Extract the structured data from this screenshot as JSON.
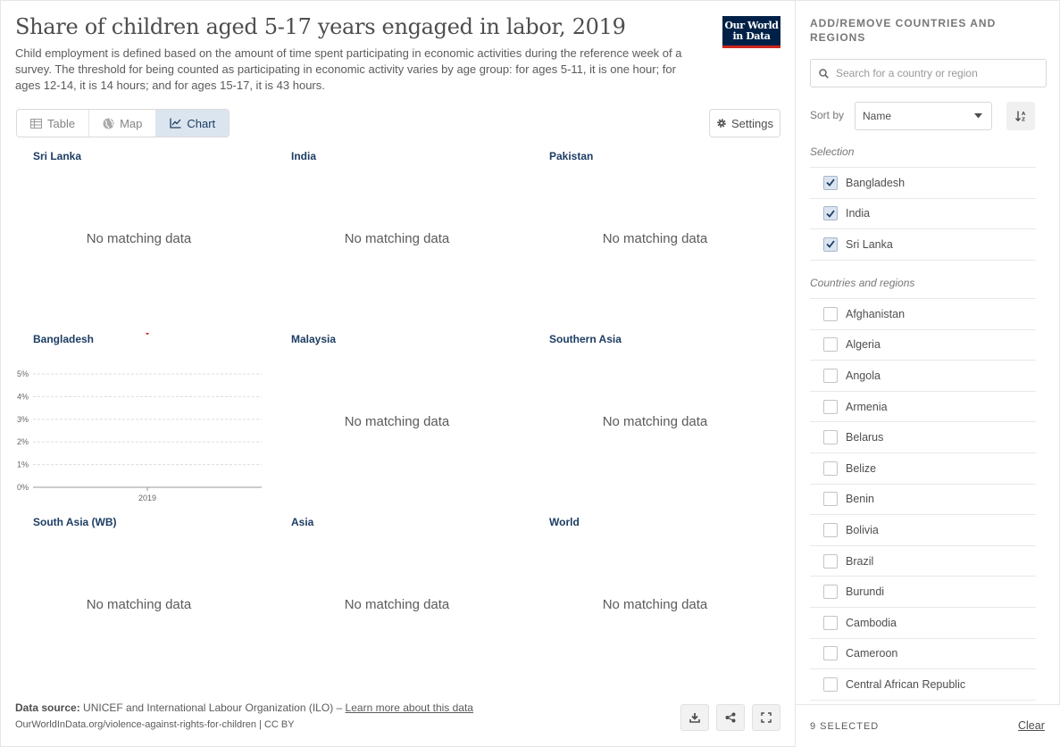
{
  "header": {
    "title": "Share of children aged 5-17 years engaged in labor, 2019",
    "subtitle": "Child employment is defined based on the amount of time spent participating in economic activities during the reference week of a survey. The threshold for being counted as participating in economic activity varies by age group: for ages 5-11, it is one hour; for ages 12-14, it is 14 hours; and for ages 15-17, it is 43 hours.",
    "logo_line1": "Our World",
    "logo_line2": "in Data"
  },
  "tabs": [
    {
      "label": "Table",
      "icon": "table-icon",
      "active": false
    },
    {
      "label": "Map",
      "icon": "globe-icon",
      "active": false
    },
    {
      "label": "Chart",
      "icon": "line-chart-icon",
      "active": true
    }
  ],
  "settings_label": "Settings",
  "no_data_text": "No matching data",
  "facets": [
    {
      "name": "Sri Lanka",
      "has_data": false
    },
    {
      "name": "India",
      "has_data": false
    },
    {
      "name": "Pakistan",
      "has_data": false
    },
    {
      "name": "Bangladesh",
      "has_data": true
    },
    {
      "name": "Malaysia",
      "has_data": false
    },
    {
      "name": "Southern Asia",
      "has_data": false
    },
    {
      "name": "South Asia (WB)",
      "has_data": false
    },
    {
      "name": "Asia",
      "has_data": false
    },
    {
      "name": "World",
      "has_data": false
    }
  ],
  "chart_data": {
    "type": "scatter",
    "facet": "Bangladesh",
    "x": [
      2019
    ],
    "y": [
      6.8
    ],
    "x_ticks": [
      "2019"
    ],
    "y_ticks": [
      "0%",
      "1%",
      "2%",
      "3%",
      "4%",
      "5%"
    ],
    "ylim": [
      0,
      5
    ],
    "point_color": "#ce261e",
    "grid": true
  },
  "footer": {
    "source_label": "Data source:",
    "source_text": "UNICEF and International Labour Organization (ILO) –",
    "learn_more": "Learn more about this data",
    "url_text": "OurWorldInData.org/violence-against-rights-for-children | CC BY"
  },
  "sidebar": {
    "heading": "Add/remove countries and regions",
    "search_placeholder": "Search for a country or region",
    "sort_label": "Sort by",
    "sort_value": "Name",
    "selection_label": "Selection",
    "selected": [
      "Bangladesh",
      "India",
      "Sri Lanka"
    ],
    "countries_label": "Countries and regions",
    "countries": [
      "Afghanistan",
      "Algeria",
      "Angola",
      "Armenia",
      "Belarus",
      "Belize",
      "Benin",
      "Bolivia",
      "Brazil",
      "Burundi",
      "Cambodia",
      "Cameroon",
      "Central African Republic"
    ],
    "selected_count": "9 SELECTED",
    "clear_label": "Clear"
  },
  "colors": {
    "accent": "#1d3d63",
    "brand": "#002147",
    "point": "#ce261e"
  }
}
